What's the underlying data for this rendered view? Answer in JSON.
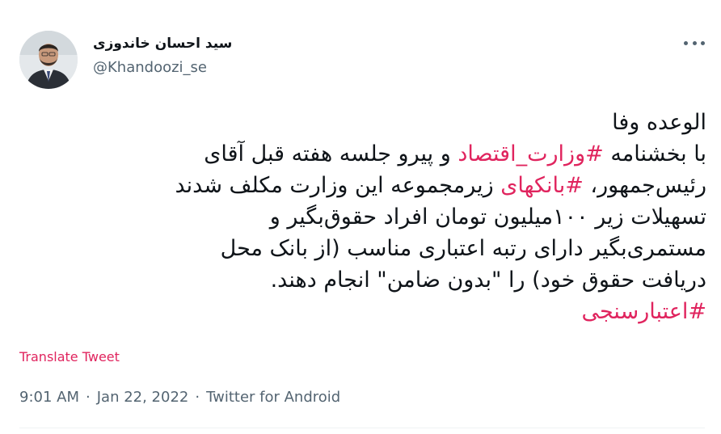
{
  "author": {
    "display_name": "سید احسان خاندوزی",
    "handle": "@Khandoozi_se"
  },
  "tweet": {
    "lines": [
      [
        {
          "text": "الوعده وفا",
          "tag": false
        }
      ],
      [
        {
          "text": "با بخشنامه ",
          "tag": false
        },
        {
          "text": "#وزارت_اقتصاد",
          "tag": true
        },
        {
          "text": " و پیرو جلسه هفته قبل آقای",
          "tag": false
        }
      ],
      [
        {
          "text": "رئیس‌جمهور، ",
          "tag": false
        },
        {
          "text": "#بانکهای",
          "tag": true
        },
        {
          "text": " زیرمجموعه این وزارت مکلف شدند",
          "tag": false
        }
      ],
      [
        {
          "text": "تسهیلات زیر ۱۰۰میلیون تومان افراد حقوق‌بگیر و",
          "tag": false
        }
      ],
      [
        {
          "text": "مستمری‌بگیر دارای رتبه اعتباری مناسب (از بانک محل",
          "tag": false
        }
      ],
      [
        {
          "text": "دریافت حقوق خود) را \"بدون ضامن\" انجام دهند.",
          "tag": false
        }
      ],
      [
        {
          "text": "#اعتبارسنجی",
          "tag": true
        }
      ]
    ]
  },
  "translate_label": "Translate Tweet",
  "meta": {
    "time": "9:01 AM",
    "separator": "·",
    "date": "Jan 22, 2022",
    "source": "Twitter for Android"
  },
  "colors": {
    "link": "#e0245e",
    "text": "#0f1419",
    "secondary": "#536471"
  },
  "icons": {
    "more": "more-options-icon",
    "avatar": "profile-photo"
  }
}
